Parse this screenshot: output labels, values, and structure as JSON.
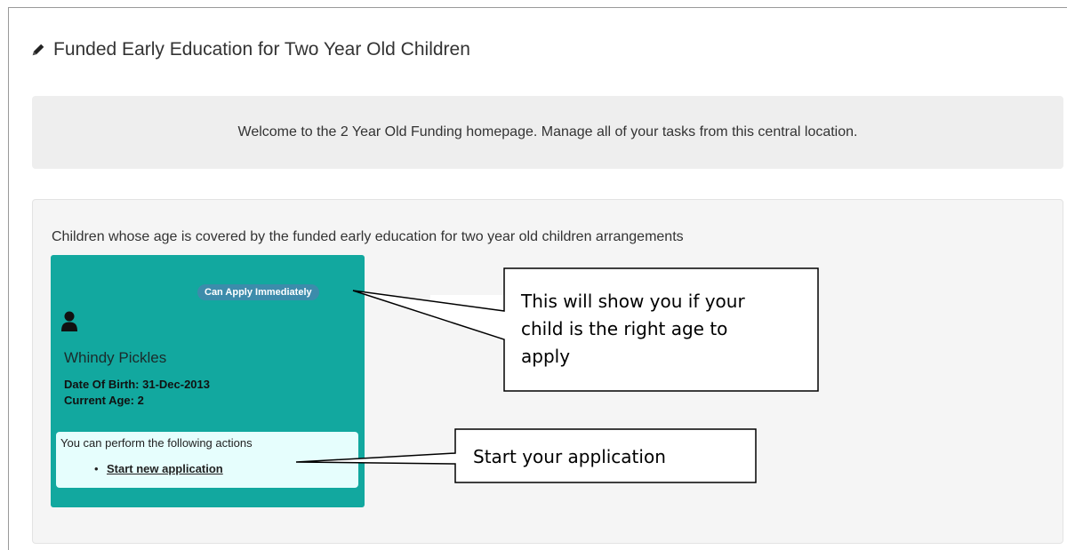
{
  "page": {
    "title": "Funded Early Education for Two Year Old Children",
    "title_icon": "pencil-icon"
  },
  "welcome": {
    "text": "Welcome to the 2 Year Old Funding homepage. Manage all of your tasks from this central location."
  },
  "children_panel": {
    "heading": "Children whose age is covered by the funded early education for two year old children arrangements",
    "card": {
      "status_badge": "Can Apply Immediately",
      "icon": "user-icon",
      "name": "Whindy Pickles",
      "dob": "Date Of Birth: 31-Dec-2013",
      "age": "Current Age: 2",
      "actions_title": "You can perform the following actions",
      "actions": [
        {
          "label": "Start new application"
        }
      ]
    }
  },
  "callouts": [
    {
      "lines": [
        "This will show you if your",
        "child is the right age to",
        "apply"
      ]
    },
    {
      "lines": [
        "Start your application"
      ]
    }
  ],
  "colors": {
    "card_bg": "#12a89f",
    "badge_bg": "#3c8cab",
    "actions_bg": "#e6fefd",
    "welcome_bg": "#eeeeee",
    "panel_bg": "#f5f5f5"
  }
}
